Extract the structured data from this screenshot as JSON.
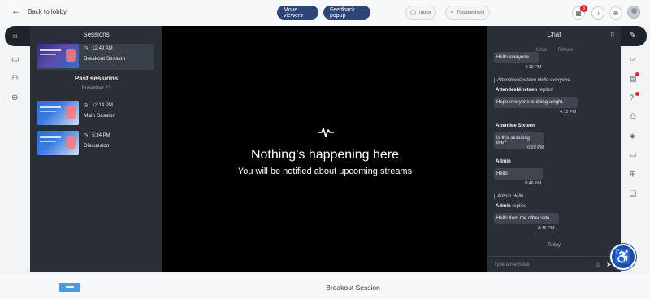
{
  "topbar": {
    "back_label": "Back to lobby",
    "move_viewers_label": "Move viewers",
    "feedback_popup_label": "Feedback popup",
    "inbox_label": "Inbox",
    "troubleshoot_label": "Troubleshoot",
    "notification_count": "3"
  },
  "sessions_panel": {
    "title": "Sessions",
    "current": [
      {
        "time": "12:49 AM",
        "name": "Breakout Session"
      }
    ],
    "past_title": "Past sessions",
    "past_date": "November 13",
    "past": [
      {
        "time": "12:14 PM",
        "name": "Main Session"
      },
      {
        "time": "5:34 PM",
        "name": "Discussion"
      }
    ]
  },
  "video": {
    "title": "Nothing’s happening here",
    "subtitle": "You will be notified about upcoming streams"
  },
  "chat": {
    "title": "Chat",
    "tabs": [
      "Chat",
      "Private"
    ],
    "messages": {
      "m1_text": "Hello everyone",
      "m1_time": "4:12 PM",
      "m2_quote_author": "AttendeeNineteen",
      "m2_quote_text": "Hello everyone",
      "m2_author": "AttendeeNineteen",
      "m2_replied": "replied",
      "m2_text": "Hope everyone is doing alright.",
      "m2_time": "4:12 PM",
      "m3_author": "Attendee Sixteen",
      "m3_text": "Is this sessiong live?",
      "m3_time": "6:29 PM",
      "m4_author": "Admin",
      "m4_text": "Hello",
      "m4_time": "8:46 PM",
      "m5_quote_author": "Admin",
      "m5_quote_text": "Hello",
      "m5_author": "Admin",
      "m5_replied": "replied",
      "m5_text": "Hello from the other side",
      "m5_time": "8:46 PM"
    },
    "today_label": "Today",
    "input_placeholder": "Type a message"
  },
  "bottom": {
    "session_title": "Breakout Session"
  },
  "colors": {
    "primary_button": "#2e4677",
    "panel": "#2a2f37",
    "video_bg": "#000000",
    "accessibility": "#1e4f9c",
    "badge": "#e0262a"
  },
  "icons": {
    "left_rail": [
      "lightbulb-icon",
      "presentation-icon",
      "people-icon",
      "globe-icon"
    ],
    "right_rail": [
      "edit-icon",
      "chat-bubbles-icon",
      "poll-icon",
      "qa-icon",
      "groups-icon",
      "layers-icon",
      "id-card-icon",
      "grid-icon",
      "speech-icon"
    ]
  }
}
